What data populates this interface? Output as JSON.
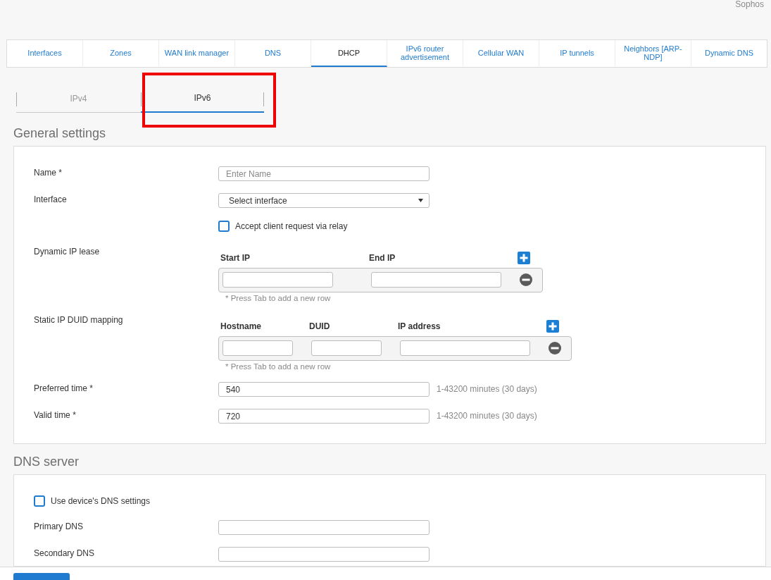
{
  "header": {
    "brand": "Sophos"
  },
  "tabs": [
    {
      "label": "Interfaces",
      "selected": false
    },
    {
      "label": "Zones",
      "selected": false
    },
    {
      "label": "WAN link manager",
      "selected": false
    },
    {
      "label": "DNS",
      "selected": false
    },
    {
      "label": "DHCP",
      "selected": true
    },
    {
      "label": "IPv6 router advertisement",
      "selected": false
    },
    {
      "label": "Cellular WAN",
      "selected": false
    },
    {
      "label": "IP tunnels",
      "selected": false
    },
    {
      "label": "Neighbors [ARP-NDP]",
      "selected": false
    },
    {
      "label": "Dynamic DNS",
      "selected": false
    }
  ],
  "subtabs": [
    {
      "label": "IPv4",
      "selected": false,
      "highlighted": false
    },
    {
      "label": "IPv6",
      "selected": true,
      "highlighted": true
    }
  ],
  "sections": [
    {
      "title": "General settings",
      "rows": [
        {
          "kind": "text",
          "label": "Name *",
          "placeholder": "Enter Name"
        },
        {
          "kind": "select",
          "label": "Interface",
          "value": "Select interface"
        },
        {
          "kind": "checkbox",
          "option": "Accept client request via relay",
          "checked": false
        },
        {
          "kind": "grid",
          "label": "Dynamic IP lease",
          "columns": [
            "Start IP",
            "End IP"
          ],
          "hint": "* Press Tab to add a new row"
        },
        {
          "kind": "grid",
          "label": "Static IP DUID mapping",
          "columns": [
            "Hostname",
            "DUID",
            "IP address"
          ],
          "hint": "* Press Tab to add a new row"
        },
        {
          "kind": "text",
          "label": "Preferred time *",
          "value": "540",
          "help": "1-43200 minutes (30 days)"
        },
        {
          "kind": "text",
          "label": "Valid time *",
          "value": "720",
          "help": "1-43200 minutes (30 days)"
        }
      ]
    },
    {
      "title": "DNS server",
      "rows": [
        {
          "kind": "wide-checkbox",
          "option": "Use device's DNS settings",
          "checked": false
        },
        {
          "kind": "text",
          "label": "Primary DNS"
        },
        {
          "kind": "text",
          "label": "Secondary DNS"
        }
      ]
    }
  ]
}
